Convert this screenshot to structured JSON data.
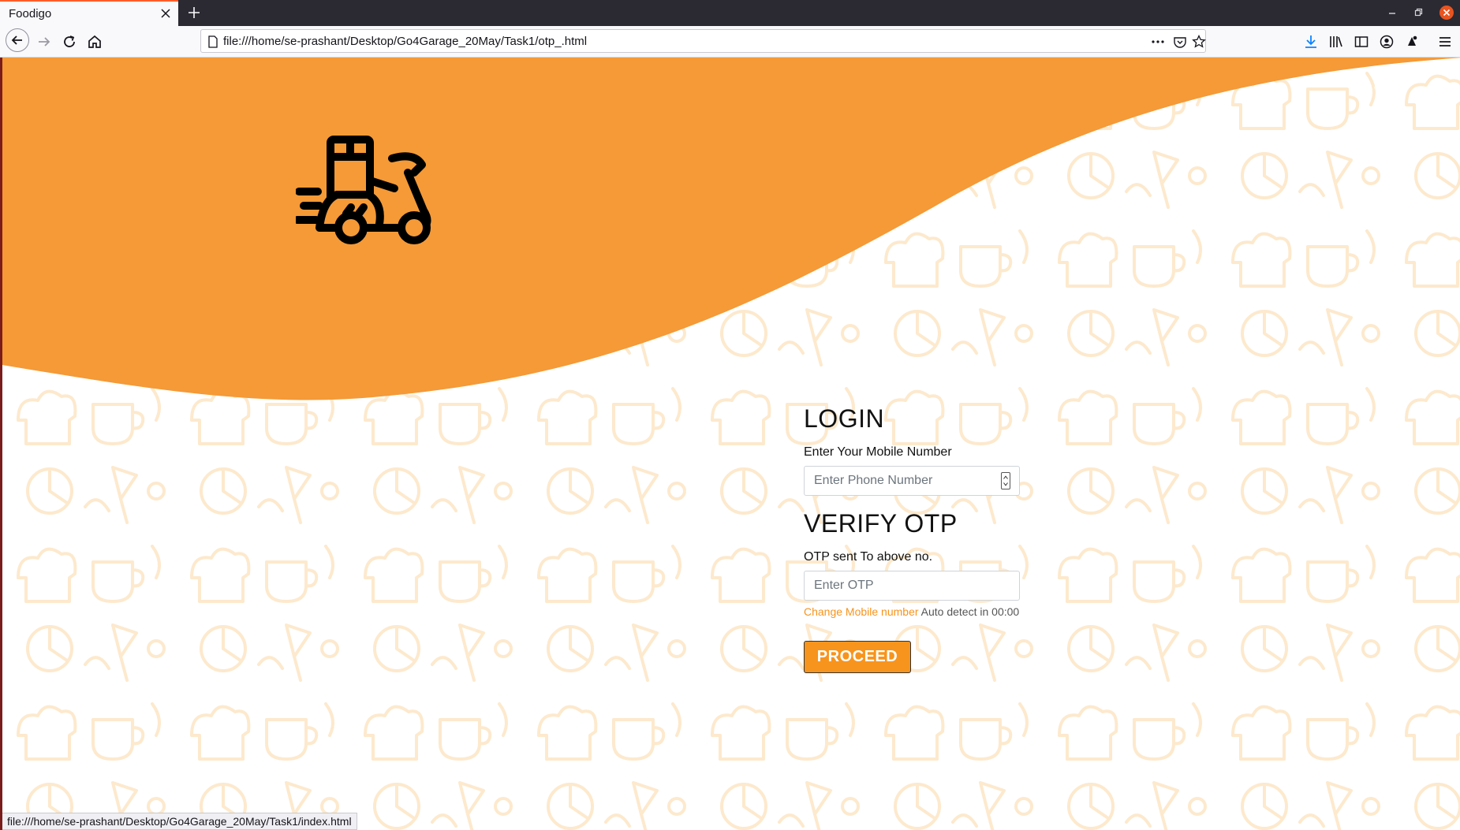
{
  "browser": {
    "tab_title": "Foodigo",
    "url": "file:///home/se-prashant/Desktop/Go4Garage_20May/Task1/otp_.html",
    "status_url": "file:///home/se-prashant/Desktop/Go4Garage_20May/Task1/index.html"
  },
  "theme": {
    "accent": "#f7941d",
    "pattern": "#fde9cd"
  },
  "login": {
    "heading": "LOGIN",
    "mobile_label": "Enter Your Mobile Number",
    "phone_placeholder": "Enter Phone Number"
  },
  "otp": {
    "heading": "VERIFY OTP",
    "sent_label": "OTP sent To above no.",
    "otp_placeholder": "Enter OTP",
    "change_link": "Change Mobile number",
    "auto_detect": "Auto detect in 00:00"
  },
  "proceed_label": "PROCEED"
}
